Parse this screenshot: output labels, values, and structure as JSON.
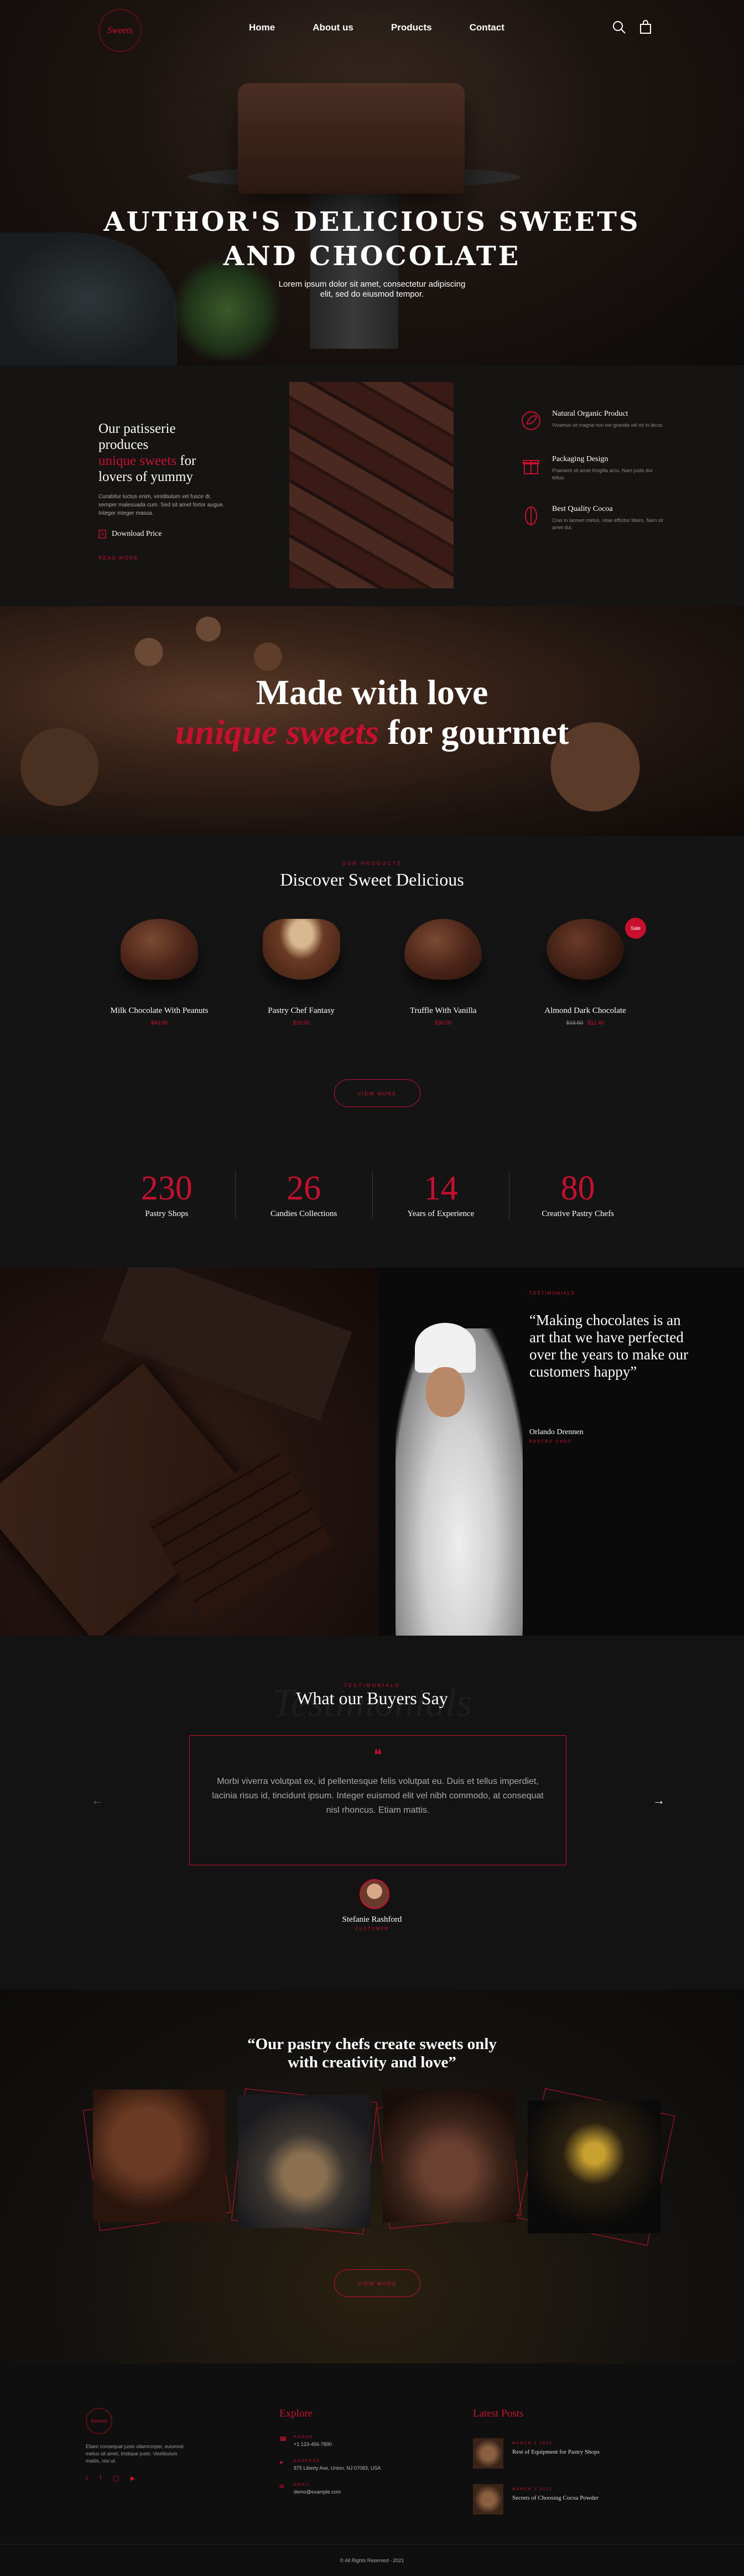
{
  "header": {
    "logo": "Sweets",
    "nav": [
      "Home",
      "About us",
      "Products",
      "Contact"
    ],
    "icons": [
      "search-icon",
      "cart-icon"
    ]
  },
  "hero": {
    "title_line1": "AUTHOR'S DELICIOUS SWEETS",
    "title_line2": "AND CHOCOLATE",
    "subtitle_line1": "Lorem ipsum dolor sit amet, consectetur adipiscing",
    "subtitle_line2": "elit, sed do eiusmod tempor."
  },
  "intro": {
    "heading_pre": "Our patisserie produces",
    "heading_red": "unique sweets",
    "heading_post": "for lovers of yummy",
    "body": "Curabitur luctus enim, vestibulum vel fusce dr, semper malesuada cum. Sed sit amet fortor augue. Integer integer massa.",
    "download": "Download Price",
    "read_more": "READ MORE",
    "features": [
      {
        "icon": "leaf-icon",
        "title": "Natural Organic Product",
        "text": "Vivamus sit magna non est gravida vel mi in lacus."
      },
      {
        "icon": "gift-icon",
        "title": "Packaging Design",
        "text": "Praesent sit amet fringilla arcu. Nam justo dui tellus."
      },
      {
        "icon": "cocoa-icon",
        "title": "Best Quality Cocoa",
        "text": "Cras in laoreet metus, vitae efficitur libero. Nam sit amet dui."
      }
    ]
  },
  "love": {
    "line1": "Made with love",
    "line2_red": "unique sweets",
    "line2_post": "for gourmet"
  },
  "products": {
    "eyebrow": "OUR PRODUCTS",
    "title": "Discover Sweet Delicious",
    "items": [
      {
        "name": "Milk Chocolate With Peanuts",
        "price": "$40.00",
        "old": "",
        "badge": ""
      },
      {
        "name": "Pastry Chef Fantasy",
        "price": "$18.00",
        "old": "",
        "badge": ""
      },
      {
        "name": "Truffle With Vanilla",
        "price": "$30.00",
        "old": "",
        "badge": ""
      },
      {
        "name": "Almond Dark Chocolate",
        "price": "$11.40",
        "old": "$16.50",
        "badge": "Sale"
      }
    ],
    "button": "VIEW MORE"
  },
  "stats": [
    {
      "num": "230",
      "label": "Pastry Shops"
    },
    {
      "num": "26",
      "label": "Candies Collections"
    },
    {
      "num": "14",
      "label": "Years of Experience"
    },
    {
      "num": "80",
      "label": "Creative Pastry Chefs"
    }
  ],
  "chef": {
    "eyebrow": "TESTIMONIALS",
    "quote": "“Making chocolates is an art that we have perfected over the years to make our customers happy”",
    "name": "Orlando Drennen",
    "role": "PASTRY CHEF"
  },
  "testimonials": {
    "ghost": "Testimonials",
    "eyebrow": "TESTIMONIALS",
    "title": "What our Buyers Say",
    "quote": "Morbi viverra volutpat ex, id pellentesque felis volutpat eu. Duis et tellus imperdiet, lacinia risus id, tincidunt ipsum. Integer euismod elit vel nibh commodo, at consequat nisl rhoncus. Etiam mattis.",
    "name": "Stefanie Rashford",
    "role": "CUSTOMER"
  },
  "gallery": {
    "title_line1": "“Our pastry chefs create sweets only",
    "title_line2": "with creativity and love”",
    "button": "VIEW MORE"
  },
  "footer": {
    "logo": "Sweets",
    "about": "Etiam consequat justo ullamcorper, euismod metus sit amet, tristique justo. Vestibulum mattis, nisi ut.",
    "socials": [
      "twitter-icon",
      "facebook-icon",
      "instagram-icon",
      "youtube-icon"
    ],
    "explore_title": "Explore",
    "contacts": [
      {
        "icon": "phone-icon",
        "label": "PHONE",
        "value": "+1 123-456-7890"
      },
      {
        "icon": "location-icon",
        "label": "ADDRESS",
        "value": "875 Liberty Ave, Union, NJ 07083, USA"
      },
      {
        "icon": "mail-icon",
        "label": "EMAIL",
        "value": "demo@example.com"
      }
    ],
    "posts_title": "Latest Posts",
    "posts": [
      {
        "date": "MARCH 2 2021",
        "title": "Rest of Equipment for Pastry Shops"
      },
      {
        "date": "MARCH 2 2021",
        "title": "Secrets of Choosing Cocoa Powder"
      }
    ],
    "copyright": "© All Rights Reserved - 2021"
  }
}
